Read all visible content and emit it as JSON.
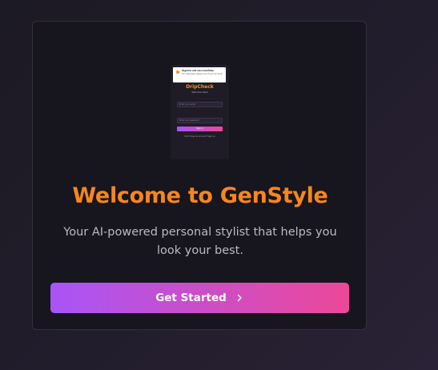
{
  "preview": {
    "toast_title": "Signed out successfully",
    "toast_message": "You have been signed out of your account.",
    "brand": "DripCheck",
    "brand_sub": "Welcome back",
    "email_placeholder": "Enter your email",
    "password_placeholder": "Enter your password",
    "signin_label": "Sign in",
    "signup_text": "Don't have an account? Sign up"
  },
  "welcome": {
    "title": "Welcome to GenStyle",
    "subtitle": "Your AI-powered personal stylist that helps you look your best.",
    "cta_label": "Get Started",
    "cta_icon": "chevron-right-icon"
  },
  "colors": {
    "accent": "#f7861e",
    "gradient_start": "#a855f7",
    "gradient_end": "#ec4899",
    "card_bg": "#17151d"
  }
}
